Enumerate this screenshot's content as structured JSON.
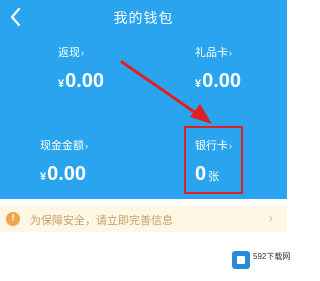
{
  "header": {
    "title": "我的钱包",
    "background": "#2aa4ee"
  },
  "wallet": {
    "rebate": {
      "label": "返现",
      "currency": "¥",
      "value": "0.00"
    },
    "giftcard": {
      "label": "礼品卡",
      "currency": "¥",
      "value": "0.00"
    },
    "cash": {
      "label": "现金金额",
      "currency": "¥",
      "value": "0.00"
    },
    "bank": {
      "label": "银行卡",
      "value": "0",
      "unit": "张"
    }
  },
  "notice": {
    "text": "为保障安全，请立即完善信息"
  },
  "annotation": {
    "color": "#e02020"
  },
  "watermark": {
    "text": "592下载网"
  }
}
